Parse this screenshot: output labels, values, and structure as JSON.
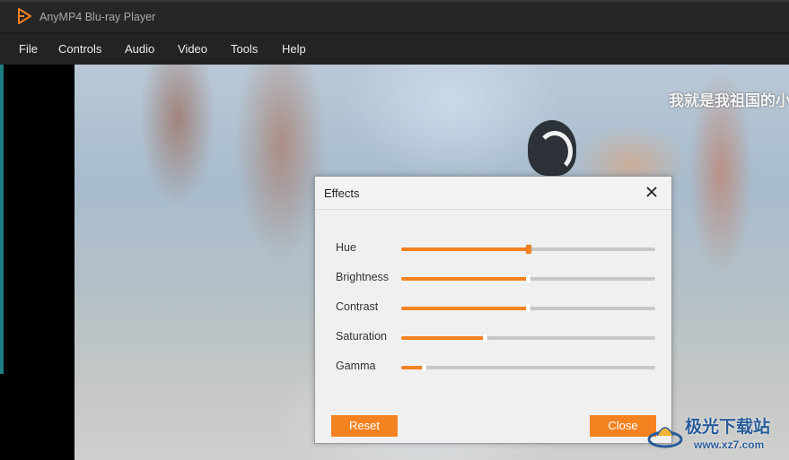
{
  "window": {
    "title": "AnyMP4 Blu-ray Player"
  },
  "menu": [
    {
      "label": "File"
    },
    {
      "label": "Controls"
    },
    {
      "label": "Audio"
    },
    {
      "label": "Video"
    },
    {
      "label": "Tools"
    },
    {
      "label": "Help"
    }
  ],
  "video": {
    "subtitle": "我就是我祖国的小"
  },
  "effects": {
    "title": "Effects",
    "sliders": [
      {
        "label": "Hue",
        "value": 0.5
      },
      {
        "label": "Brightness",
        "value": 0.5
      },
      {
        "label": "Contrast",
        "value": 0.5
      },
      {
        "label": "Saturation",
        "value": 0.33
      },
      {
        "label": "Gamma",
        "value": 0.09
      }
    ],
    "reset_label": "Reset",
    "close_label": "Close"
  },
  "watermark": {
    "line1": "极光下载站",
    "line2": "www.xz7.com"
  },
  "colors": {
    "accent": "#f58220",
    "titlebar": "#262626",
    "menubar": "#232323",
    "dialog_bg": "#f0f0f0"
  }
}
